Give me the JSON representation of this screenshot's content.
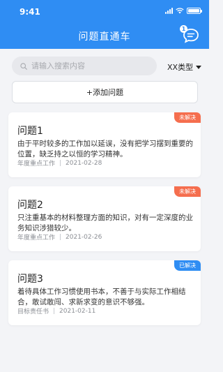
{
  "status_bar": {
    "time": "9:41"
  },
  "header": {
    "title": "问题直通车",
    "message_count": "1"
  },
  "search": {
    "placeholder": "请输入搜索内容"
  },
  "filter": {
    "selected": "XX类型"
  },
  "add_button": {
    "label": "+添加问题"
  },
  "colors": {
    "primary": "#2f8df3",
    "unresolved": "#f56e4e",
    "resolved": "#2f8df3"
  },
  "issues": [
    {
      "title": "问题1",
      "description": "由于平时较多的工作加以延误，没有把学习摆到重要的位置，缺乏持之以恒的学习精神。",
      "category": "年度重点工作",
      "date": "2021-02-28",
      "status": "未解决"
    },
    {
      "title": "问题2",
      "description": "只注重基本的材料整理方面的知识，对有一定深度的业务知识涉猎较少。",
      "category": "年度重点工作",
      "date": "2021-02-26",
      "status": "未解决"
    },
    {
      "title": "问题3",
      "description": "着待具体工作习惯使用书本，不善于与实际工作相结合，敢试敢闯、求新求变的意识不够强。",
      "category": "目标责任书",
      "date": "2021-02-11",
      "status": "已解决"
    }
  ]
}
